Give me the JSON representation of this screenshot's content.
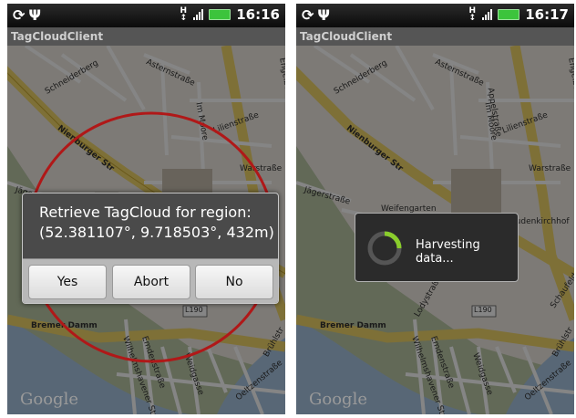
{
  "phones": [
    {
      "status_time": "16:16",
      "app_title": "TagCloudClient",
      "dialog": {
        "message_line1": "Retrieve TagCloud for region:",
        "message_line2": "(52.381107°, 9.718503°, 432m)",
        "yes_label": "Yes",
        "abort_label": "Abort",
        "no_label": "No"
      }
    },
    {
      "status_time": "16:17",
      "app_title": "TagCloudClient",
      "progress_text": "Harvesting data..."
    }
  ],
  "status_icons": {
    "left": [
      "sync-icon",
      "usb-icon"
    ],
    "right": [
      "network-h-icon",
      "signal-icon",
      "battery-icon"
    ]
  },
  "map": {
    "labels": [
      "Schneiderberg",
      "Asternstraße",
      "Lilienstraße",
      "Nienburger Str",
      "Im Moore",
      "Jägerstraße",
      "Warstraße",
      "Engelbosteler Damm",
      "L190",
      "Bremer Damm",
      "Emdenstraße",
      "Wilhelmshavener Str",
      "Weidgasse",
      "Oeltzenstraße",
      "Brühlstr",
      "Weifengarten",
      "Judenkirchhof",
      "Lodystraße",
      "Schaufelder",
      "Appelstraße"
    ],
    "attribution": "Google"
  },
  "colors": {
    "status_bar": "#111111",
    "battery": "#3cc43c",
    "region_circle": "#b01818",
    "dialog_bg": "#4a4a4a",
    "spinner": "#8acd2c"
  }
}
